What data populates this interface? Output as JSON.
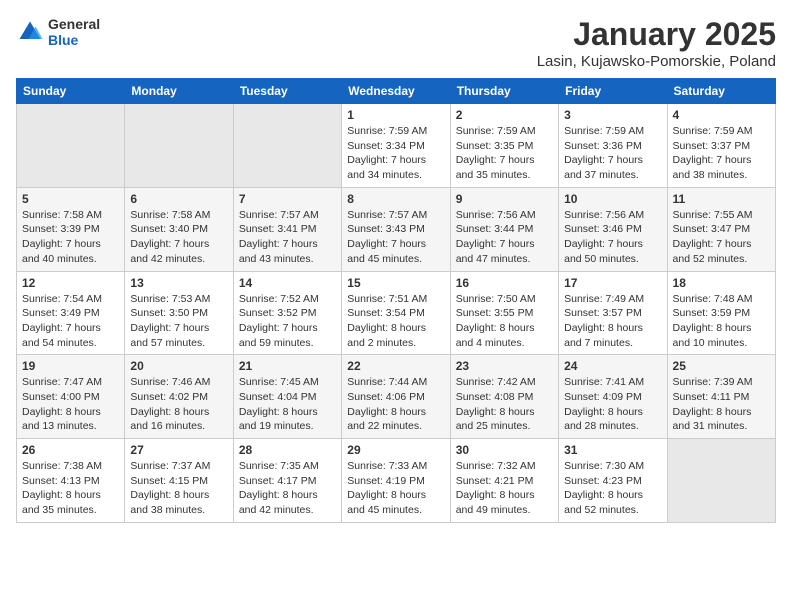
{
  "header": {
    "logo_general": "General",
    "logo_blue": "Blue",
    "month_title": "January 2025",
    "location": "Lasin, Kujawsko-Pomorskie, Poland"
  },
  "weekdays": [
    "Sunday",
    "Monday",
    "Tuesday",
    "Wednesday",
    "Thursday",
    "Friday",
    "Saturday"
  ],
  "weeks": [
    [
      {
        "day": "",
        "info": ""
      },
      {
        "day": "",
        "info": ""
      },
      {
        "day": "",
        "info": ""
      },
      {
        "day": "1",
        "info": "Sunrise: 7:59 AM\nSunset: 3:34 PM\nDaylight: 7 hours and 34 minutes."
      },
      {
        "day": "2",
        "info": "Sunrise: 7:59 AM\nSunset: 3:35 PM\nDaylight: 7 hours and 35 minutes."
      },
      {
        "day": "3",
        "info": "Sunrise: 7:59 AM\nSunset: 3:36 PM\nDaylight: 7 hours and 37 minutes."
      },
      {
        "day": "4",
        "info": "Sunrise: 7:59 AM\nSunset: 3:37 PM\nDaylight: 7 hours and 38 minutes."
      }
    ],
    [
      {
        "day": "5",
        "info": "Sunrise: 7:58 AM\nSunset: 3:39 PM\nDaylight: 7 hours and 40 minutes."
      },
      {
        "day": "6",
        "info": "Sunrise: 7:58 AM\nSunset: 3:40 PM\nDaylight: 7 hours and 42 minutes."
      },
      {
        "day": "7",
        "info": "Sunrise: 7:57 AM\nSunset: 3:41 PM\nDaylight: 7 hours and 43 minutes."
      },
      {
        "day": "8",
        "info": "Sunrise: 7:57 AM\nSunset: 3:43 PM\nDaylight: 7 hours and 45 minutes."
      },
      {
        "day": "9",
        "info": "Sunrise: 7:56 AM\nSunset: 3:44 PM\nDaylight: 7 hours and 47 minutes."
      },
      {
        "day": "10",
        "info": "Sunrise: 7:56 AM\nSunset: 3:46 PM\nDaylight: 7 hours and 50 minutes."
      },
      {
        "day": "11",
        "info": "Sunrise: 7:55 AM\nSunset: 3:47 PM\nDaylight: 7 hours and 52 minutes."
      }
    ],
    [
      {
        "day": "12",
        "info": "Sunrise: 7:54 AM\nSunset: 3:49 PM\nDaylight: 7 hours and 54 minutes."
      },
      {
        "day": "13",
        "info": "Sunrise: 7:53 AM\nSunset: 3:50 PM\nDaylight: 7 hours and 57 minutes."
      },
      {
        "day": "14",
        "info": "Sunrise: 7:52 AM\nSunset: 3:52 PM\nDaylight: 7 hours and 59 minutes."
      },
      {
        "day": "15",
        "info": "Sunrise: 7:51 AM\nSunset: 3:54 PM\nDaylight: 8 hours and 2 minutes."
      },
      {
        "day": "16",
        "info": "Sunrise: 7:50 AM\nSunset: 3:55 PM\nDaylight: 8 hours and 4 minutes."
      },
      {
        "day": "17",
        "info": "Sunrise: 7:49 AM\nSunset: 3:57 PM\nDaylight: 8 hours and 7 minutes."
      },
      {
        "day": "18",
        "info": "Sunrise: 7:48 AM\nSunset: 3:59 PM\nDaylight: 8 hours and 10 minutes."
      }
    ],
    [
      {
        "day": "19",
        "info": "Sunrise: 7:47 AM\nSunset: 4:00 PM\nDaylight: 8 hours and 13 minutes."
      },
      {
        "day": "20",
        "info": "Sunrise: 7:46 AM\nSunset: 4:02 PM\nDaylight: 8 hours and 16 minutes."
      },
      {
        "day": "21",
        "info": "Sunrise: 7:45 AM\nSunset: 4:04 PM\nDaylight: 8 hours and 19 minutes."
      },
      {
        "day": "22",
        "info": "Sunrise: 7:44 AM\nSunset: 4:06 PM\nDaylight: 8 hours and 22 minutes."
      },
      {
        "day": "23",
        "info": "Sunrise: 7:42 AM\nSunset: 4:08 PM\nDaylight: 8 hours and 25 minutes."
      },
      {
        "day": "24",
        "info": "Sunrise: 7:41 AM\nSunset: 4:09 PM\nDaylight: 8 hours and 28 minutes."
      },
      {
        "day": "25",
        "info": "Sunrise: 7:39 AM\nSunset: 4:11 PM\nDaylight: 8 hours and 31 minutes."
      }
    ],
    [
      {
        "day": "26",
        "info": "Sunrise: 7:38 AM\nSunset: 4:13 PM\nDaylight: 8 hours and 35 minutes."
      },
      {
        "day": "27",
        "info": "Sunrise: 7:37 AM\nSunset: 4:15 PM\nDaylight: 8 hours and 38 minutes."
      },
      {
        "day": "28",
        "info": "Sunrise: 7:35 AM\nSunset: 4:17 PM\nDaylight: 8 hours and 42 minutes."
      },
      {
        "day": "29",
        "info": "Sunrise: 7:33 AM\nSunset: 4:19 PM\nDaylight: 8 hours and 45 minutes."
      },
      {
        "day": "30",
        "info": "Sunrise: 7:32 AM\nSunset: 4:21 PM\nDaylight: 8 hours and 49 minutes."
      },
      {
        "day": "31",
        "info": "Sunrise: 7:30 AM\nSunset: 4:23 PM\nDaylight: 8 hours and 52 minutes."
      },
      {
        "day": "",
        "info": ""
      }
    ]
  ]
}
